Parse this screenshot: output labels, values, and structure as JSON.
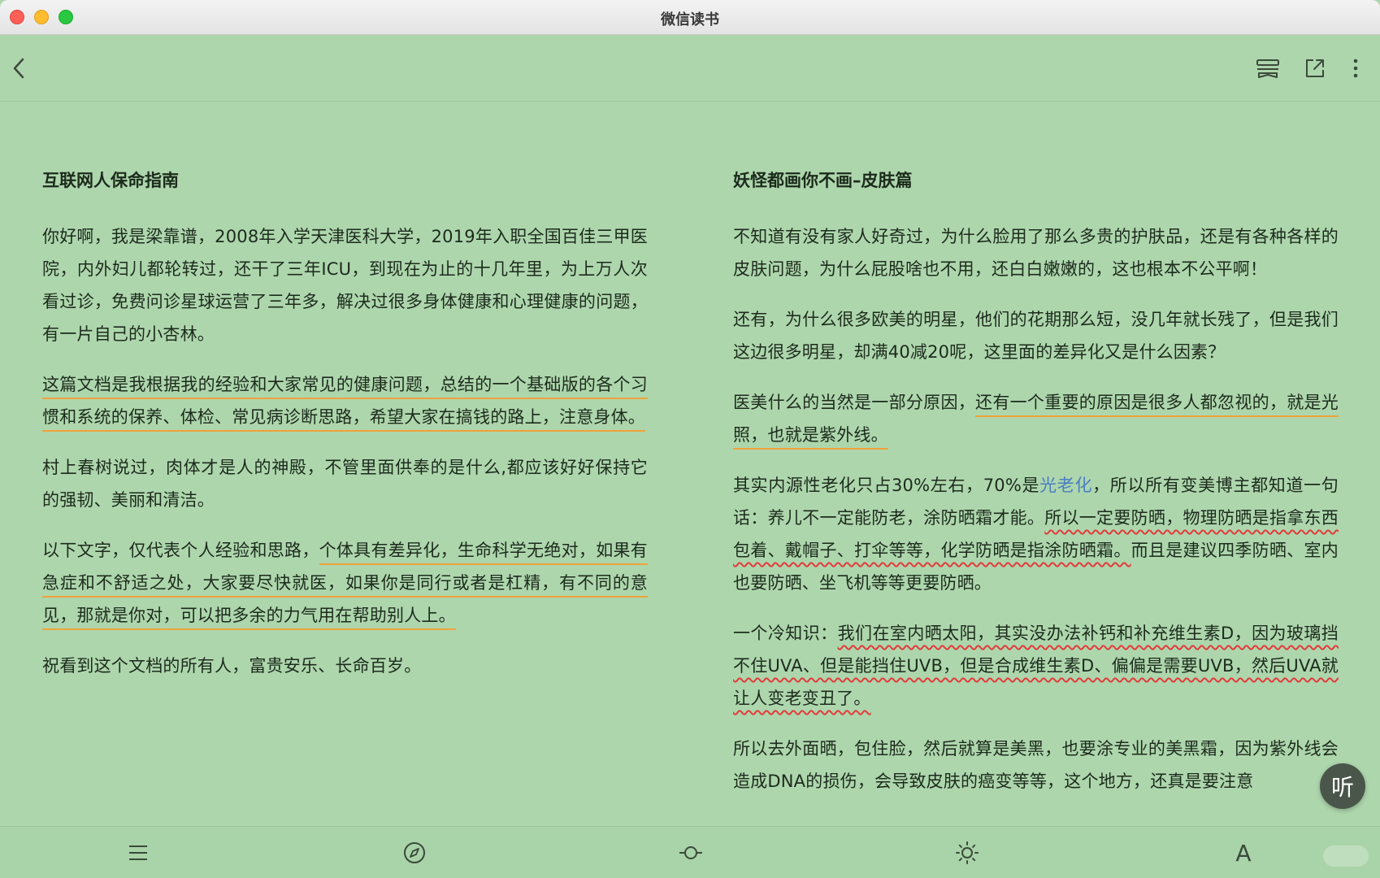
{
  "window": {
    "title": "微信读书"
  },
  "icons": {
    "back": "chevron-left-icon",
    "bookmark": "bookmark-icon",
    "share": "share-icon",
    "more": "more-vertical-icon",
    "listen": "listen-icon",
    "menu": "menu-icon",
    "compass": "compass-icon",
    "progress": "progress-icon",
    "brightness": "brightness-icon",
    "font": "font-icon"
  },
  "colors": {
    "background": "#aed6ad",
    "underline_orange": "#f0a23a",
    "underline_wavy": "#e23b3b",
    "link": "#4a7fc1"
  },
  "left_page": {
    "title": "互联网人保命指南",
    "p1": "你好啊，我是梁靠谱，2008年入学天津医科大学，2019年入职全国百佳三甲医院，内外妇儿都轮转过，还干了三年ICU，到现在为止的十几年里，为上万人次看过诊，免费问诊星球运营了三年多，解决过很多身体健康和心理健康的问题，有一片自己的小杏林。",
    "p2": "这篇文档是我根据我的经验和大家常见的健康问题，总结的一个基础版的各个习惯和系统的保养、体检、常见病诊断思路，希望大家在搞钱的路上，注意身体。",
    "p3": "村上春树说过，肉体才是人的神殿，不管里面供奉的是什么,都应该好好保持它的强韧、美丽和清洁。",
    "p4_a": "以下文字，仅代表个人经验和思路，",
    "p4_b": "个体具有差异化，生命科学无绝对，如果有急症和不舒适之处，大家要尽快就医，如果你是同行或者是杠精，有不同的意见，那就是你对，可以把多余的力气用在帮助别人上。",
    "p5": "祝看到这个文档的所有人，富贵安乐、长命百岁。"
  },
  "right_page": {
    "title": "妖怪都画你不画–皮肤篇",
    "p1": "不知道有没有家人好奇过，为什么脸用了那么多贵的护肤品，还是有各种各样的皮肤问题，为什么屁股啥也不用，还白白嫩嫩的，这也根本不公平啊！",
    "p2": "还有，为什么很多欧美的明星，他们的花期那么短，没几年就长残了，但是我们这边很多明星，却满40减20呢，这里面的差异化又是什么因素？",
    "p3_a": "医美什么的当然是一部分原因，",
    "p3_b": "还有一个重要的原因是很多人都忽视的，就是光照，也就是紫外线。",
    "p4_a": "其实内源性老化只占30%左右，70%是",
    "p4_link": "光老化",
    "p4_b": "，所以所有变美博主都知道一句话：养儿不一定能防老，涂防晒霜才能。",
    "p4_c": "所以一定要防晒，物理防晒是指拿东西包着、戴帽子、打伞等等，化学防晒是指涂防晒霜。",
    "p4_d": "而且是建议四季防晒、室内也要防晒、坐飞机等等更要防晒。",
    "p5_a": "一个冷知识：",
    "p5_b": "我们在室内晒太阳，其实没办法补钙和补充维生素D，因为玻璃挡不住UVA、但是能挡住UVB，但是合成维生素D、偏偏是需要UVB，然后UVA就让人变老变丑了。",
    "p6": "所以去外面晒，包住脸，然后就算是美黑，也要涂专业的美黑霜，因为紫外线会造成DNA的损伤，会导致皮肤的癌变等等，这个地方，还真是要注意"
  },
  "listen_label": "听",
  "font_label": "A"
}
